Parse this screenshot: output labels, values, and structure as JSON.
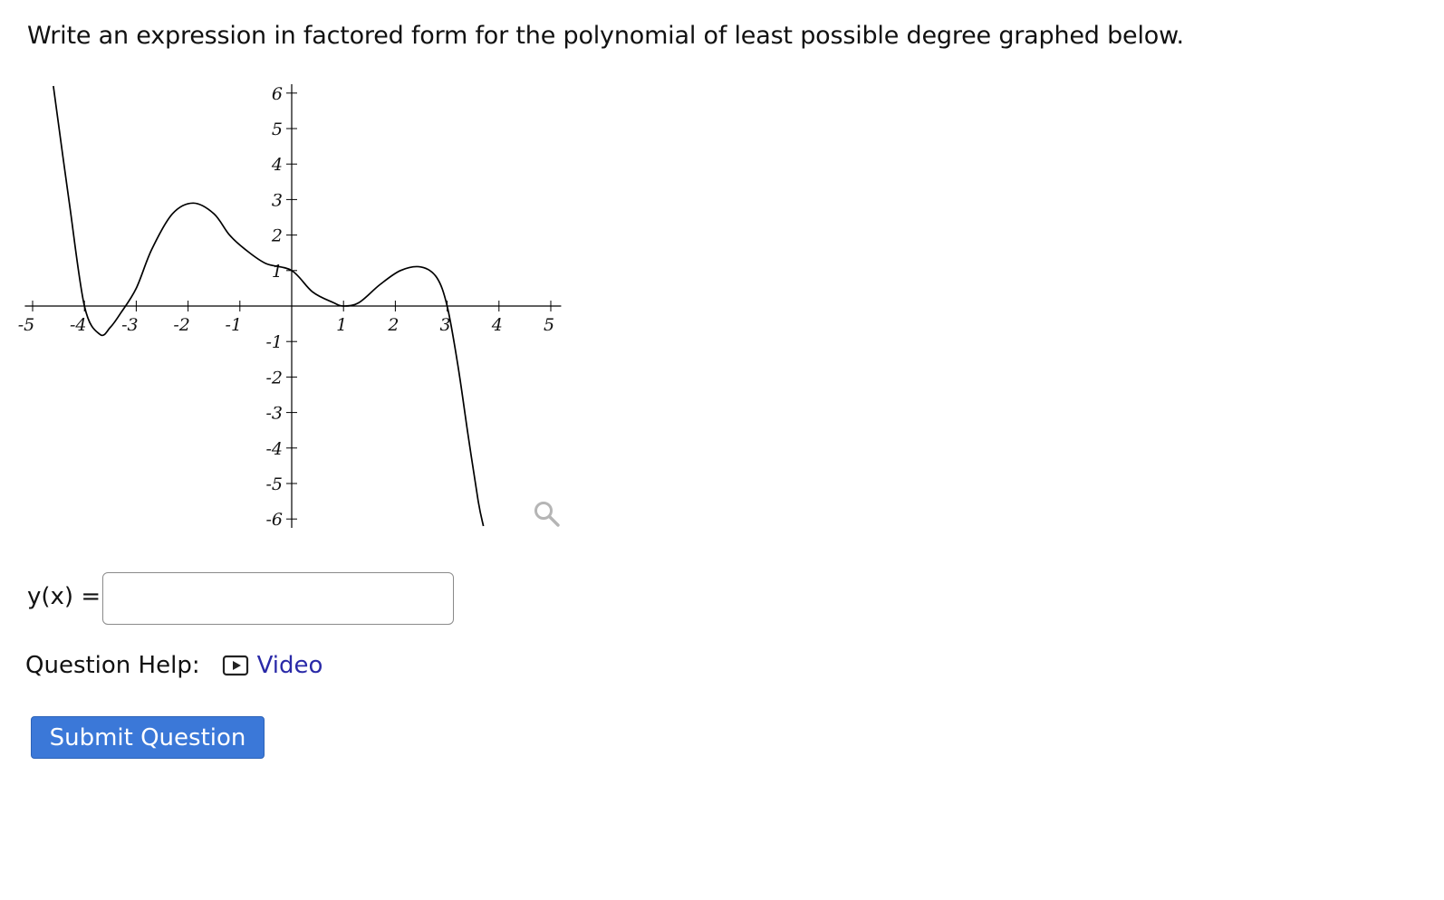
{
  "question": {
    "text": "Write an expression in factored form for the polynomial of least possible degree graphed below."
  },
  "graph": {
    "x_ticks": [
      "-5",
      "-4",
      "-3",
      "-2",
      "-1",
      "1",
      "2",
      "3",
      "4",
      "5"
    ],
    "y_ticks": [
      "6",
      "5",
      "4",
      "3",
      "2",
      "1",
      "-1",
      "-2",
      "-3",
      "-4",
      "-5",
      "-6"
    ],
    "xlim": [
      -5,
      5
    ],
    "ylim": [
      -6,
      6
    ],
    "zoom_icon": "magnifier-icon"
  },
  "chart_data": {
    "type": "line",
    "title": "",
    "xlabel": "",
    "ylabel": "",
    "xlim": [
      -5.2,
      5.2
    ],
    "ylim": [
      -6.2,
      6.2
    ],
    "grid": false,
    "x_ticks": [
      -5,
      -4,
      -3,
      -2,
      -1,
      1,
      2,
      3,
      4,
      5
    ],
    "y_ticks": [
      -6,
      -5,
      -4,
      -3,
      -2,
      -1,
      1,
      2,
      3,
      4,
      5,
      6
    ],
    "series": [
      {
        "values_x": [
          -4.6,
          -4.3,
          -4.0,
          -3.7,
          -3.5,
          -3.3,
          -3.0,
          -2.7,
          -2.3,
          -1.9,
          -1.5,
          -1.2,
          -0.9,
          -0.5,
          0.0,
          0.4,
          0.8,
          1.0,
          1.3,
          1.7,
          2.1,
          2.5,
          2.8,
          3.0,
          3.2,
          3.4,
          3.6,
          3.7
        ],
        "values_y": [
          6.2,
          3.0,
          0.0,
          -0.8,
          -0.6,
          -0.2,
          0.5,
          1.6,
          2.6,
          2.9,
          2.6,
          2.0,
          1.6,
          1.2,
          1.0,
          0.4,
          0.1,
          0.0,
          0.1,
          0.6,
          1.0,
          1.1,
          0.8,
          0.0,
          -1.6,
          -3.6,
          -5.5,
          -6.2
        ]
      }
    ]
  },
  "answer": {
    "label": "y(x) =",
    "value": "",
    "placeholder": ""
  },
  "help": {
    "label": "Question Help:",
    "video_label": "Video",
    "video_icon": "play-video-icon"
  },
  "submit": {
    "label": "Submit Question",
    "color": "#3b78d8"
  },
  "colors": {
    "link": "#2a2aa8",
    "curve": "#000000",
    "zoom_icon": "#b5b5b5"
  }
}
